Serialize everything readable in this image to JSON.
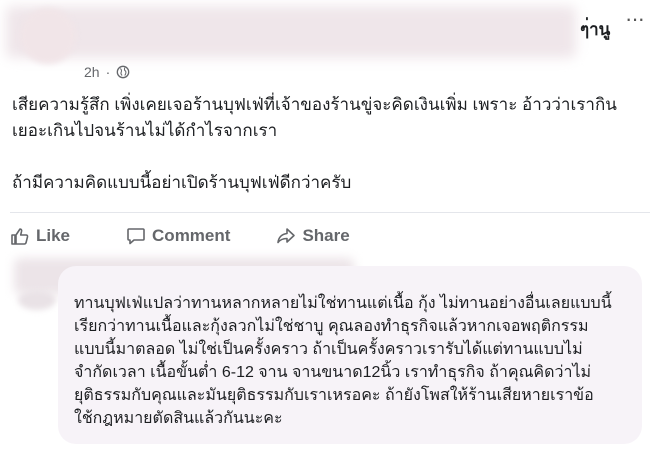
{
  "post": {
    "author_tail": "ๆ่านู",
    "time": "2h",
    "paragraphs": [
      "เสียความรู้สึก เพิ่งเคยเจอร้านบุฟเฟ่ที่เจ้าของร้านขู่จะคิดเงินเพิ่ม เพราะ อ้าวว่าเรากิน",
      "เยอะเกินไปจนร้านไม่ได้กำไรจากเรา",
      "",
      "ถ้ามีความคิดแบบนี้อย่าเปิดร้านบุฟเฟ่ดีกว่าครับ"
    ]
  },
  "actions": {
    "like": "Like",
    "comment": "Comment",
    "share": "Share"
  },
  "comment": {
    "lines": [
      "ทานบุฟเฟ่แปลว่าทานหลากหลายไม่ใช่ทานแต่เนื้อ กุ้ง ไม่ทานอย่างอื่นเลยแบบนี้",
      "เรียกว่าทานเนื้อและกุ้งลวกไม่ใช่ชาบู คุณลองทำธุรกิจแล้วหากเจอพฤติกรรม",
      "แบบนี้มาตลอด ไม่ใช่เป็นครั้งคราว ถ้าเป็นครั้งคราวเรารับได้แต่ทานแบบไม่",
      "จำกัดเวลา เนื้อขั้นต่ำ 6-12 จาน จานขนาด12นิ้ว เราทำธุรกิจ ถ้าคุณคิดว่าไม่",
      "ยุติธรรมกับคุณและมันยุติธรรมกับเราเหรอคะ ถ้ายังโพสให้ร้านเสียหายเราข้อ",
      "ใช้กฎหมายตัดสินแล้วกันนะคะ"
    ]
  },
  "icons": {
    "more": "more-dots-icon",
    "globe": "globe-icon",
    "like": "thumbs-up-icon",
    "comment": "comment-bubble-icon",
    "share": "share-arrow-icon"
  }
}
